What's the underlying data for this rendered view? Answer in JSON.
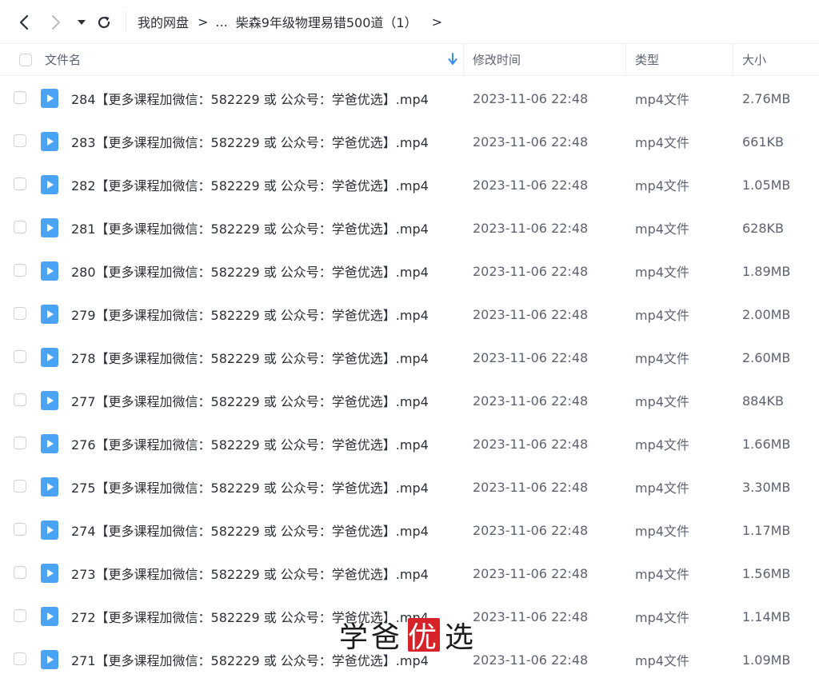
{
  "breadcrumb": {
    "root": "我的网盘",
    "ellipsis": "...",
    "current": "柴森9年级物理易错500道（1）",
    "separator": ">"
  },
  "header": {
    "name": "文件名",
    "modified": "修改时间",
    "type": "类型",
    "size": "大小"
  },
  "colors": {
    "file_icon": "#4aa3f4",
    "watermark_red": "#d6232a"
  },
  "rows": [
    {
      "name": "284【更多课程加微信：582229 或 公众号：学爸优选】.mp4",
      "date": "2023-11-06 22:48",
      "type": "mp4文件",
      "size": "2.76MB"
    },
    {
      "name": "283【更多课程加微信：582229 或 公众号：学爸优选】.mp4",
      "date": "2023-11-06 22:48",
      "type": "mp4文件",
      "size": "661KB"
    },
    {
      "name": "282【更多课程加微信：582229 或 公众号：学爸优选】.mp4",
      "date": "2023-11-06 22:48",
      "type": "mp4文件",
      "size": "1.05MB"
    },
    {
      "name": "281【更多课程加微信：582229 或 公众号：学爸优选】.mp4",
      "date": "2023-11-06 22:48",
      "type": "mp4文件",
      "size": "628KB"
    },
    {
      "name": "280【更多课程加微信：582229 或 公众号：学爸优选】.mp4",
      "date": "2023-11-06 22:48",
      "type": "mp4文件",
      "size": "1.89MB"
    },
    {
      "name": "279【更多课程加微信：582229 或 公众号：学爸优选】.mp4",
      "date": "2023-11-06 22:48",
      "type": "mp4文件",
      "size": "2.00MB"
    },
    {
      "name": "278【更多课程加微信：582229 或 公众号：学爸优选】.mp4",
      "date": "2023-11-06 22:48",
      "type": "mp4文件",
      "size": "2.60MB"
    },
    {
      "name": "277【更多课程加微信：582229 或 公众号：学爸优选】.mp4",
      "date": "2023-11-06 22:48",
      "type": "mp4文件",
      "size": "884KB"
    },
    {
      "name": "276【更多课程加微信：582229 或 公众号：学爸优选】.mp4",
      "date": "2023-11-06 22:48",
      "type": "mp4文件",
      "size": "1.66MB"
    },
    {
      "name": "275【更多课程加微信：582229 或 公众号：学爸优选】.mp4",
      "date": "2023-11-06 22:48",
      "type": "mp4文件",
      "size": "3.30MB"
    },
    {
      "name": "274【更多课程加微信：582229 或 公众号：学爸优选】.mp4",
      "date": "2023-11-06 22:48",
      "type": "mp4文件",
      "size": "1.17MB"
    },
    {
      "name": "273【更多课程加微信：582229 或 公众号：学爸优选】.mp4",
      "date": "2023-11-06 22:48",
      "type": "mp4文件",
      "size": "1.56MB"
    },
    {
      "name": "272【更多课程加微信：582229 或 公众号：学爸优选】.mp4",
      "date": "2023-11-06 22:48",
      "type": "mp4文件",
      "size": "1.14MB"
    },
    {
      "name": "271【更多课程加微信：582229 或 公众号：学爸优选】.mp4",
      "date": "2023-11-06 22:48",
      "type": "mp4文件",
      "size": "1.09MB"
    }
  ],
  "watermark": {
    "char1": "学",
    "char2": "爸",
    "char3": "优",
    "char4": "选"
  }
}
